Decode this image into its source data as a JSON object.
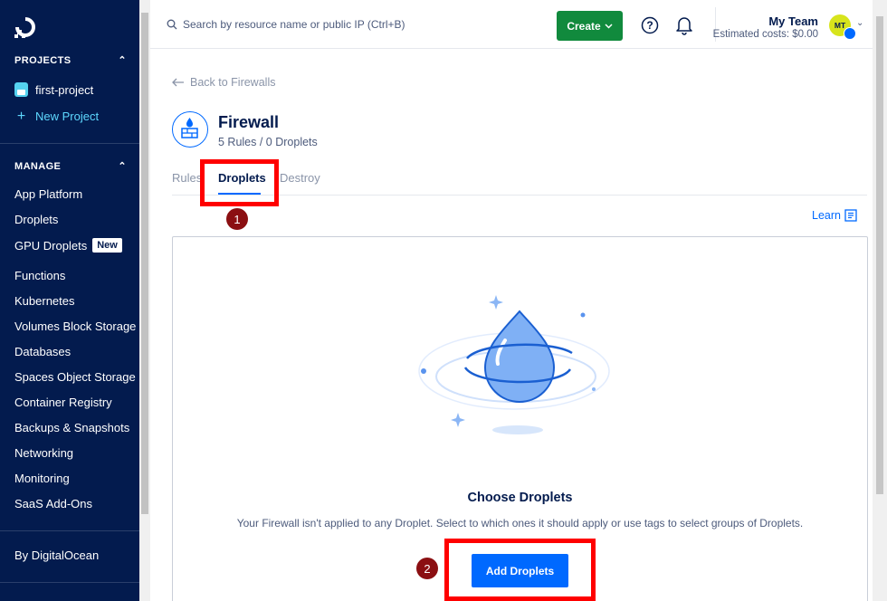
{
  "sidebar": {
    "projects_heading": "PROJECTS",
    "project_name": "first-project",
    "new_project": "New Project",
    "manage_heading": "MANAGE",
    "items": [
      {
        "label": "App Platform"
      },
      {
        "label": "Droplets"
      },
      {
        "label": "GPU Droplets",
        "badge": "New"
      },
      {
        "label": "Functions"
      },
      {
        "label": "Kubernetes"
      },
      {
        "label": "Volumes Block Storage"
      },
      {
        "label": "Databases"
      },
      {
        "label": "Spaces Object Storage"
      },
      {
        "label": "Container Registry"
      },
      {
        "label": "Backups & Snapshots"
      },
      {
        "label": "Networking"
      },
      {
        "label": "Monitoring"
      },
      {
        "label": "SaaS Add-Ons"
      }
    ],
    "footer": "By DigitalOcean"
  },
  "topbar": {
    "search_placeholder": "Search by resource name or public IP (Ctrl+B)",
    "create_label": "Create",
    "team_name": "My Team",
    "estimated_costs": "Estimated costs: $0.00",
    "avatar_initials": "MT"
  },
  "main": {
    "back_link": "Back to Firewalls",
    "title": "Firewall",
    "subtitle": "5 Rules / 0 Droplets",
    "tabs": [
      {
        "label": "Rules"
      },
      {
        "label": "Droplets",
        "active": true
      },
      {
        "label": "Destroy"
      }
    ],
    "learn_label": "Learn",
    "empty_title": "Choose Droplets",
    "empty_desc": "Your Firewall isn't applied to any Droplet. Select to which ones it should apply or use tags to select groups of Droplets.",
    "add_button": "Add Droplets"
  },
  "annotations": {
    "marker_1": "1",
    "marker_2": "2",
    "highlight_color": "#ff0000"
  },
  "colors": {
    "sidebar_bg": "#031b4e",
    "accent_blue": "#0069ff",
    "create_green": "#118a3d"
  }
}
